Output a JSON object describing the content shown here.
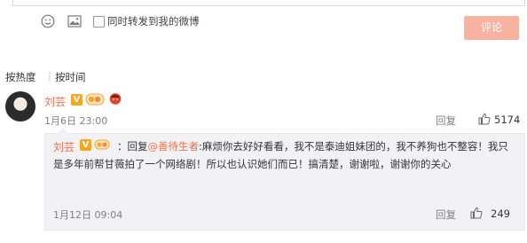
{
  "composer": {
    "repost_label": "同时转发到我的微博",
    "submit_label": "评论",
    "icons": [
      "emoji-icon",
      "image-icon"
    ]
  },
  "sort": {
    "by_hot": "按热度",
    "separator": "|",
    "by_time": "按时间"
  },
  "comment": {
    "username": "刘芸",
    "verified_badge": "V",
    "time": "1月6日 23:00",
    "reply_label": "回复",
    "likes": "5174"
  },
  "reply": {
    "username": "刘芸",
    "verified_badge": "V",
    "prefix": "：回复",
    "mention": "@善待生者",
    "text": ":麻烦你去好好看看，我不是泰迪姐妹团的，我不养狗也不整容！我只是多年前帮甘薇拍了一个网络剧！所以也认识她们而已！搞清楚，谢谢啦，谢谢你的关心",
    "time": "1月12日 09:04",
    "reply_label": "回复",
    "likes": "249"
  },
  "colors": {
    "accent": "#eb7350",
    "button": "#f7b2a0",
    "badge": "#f6a623",
    "panel": "#f2f2f5"
  }
}
